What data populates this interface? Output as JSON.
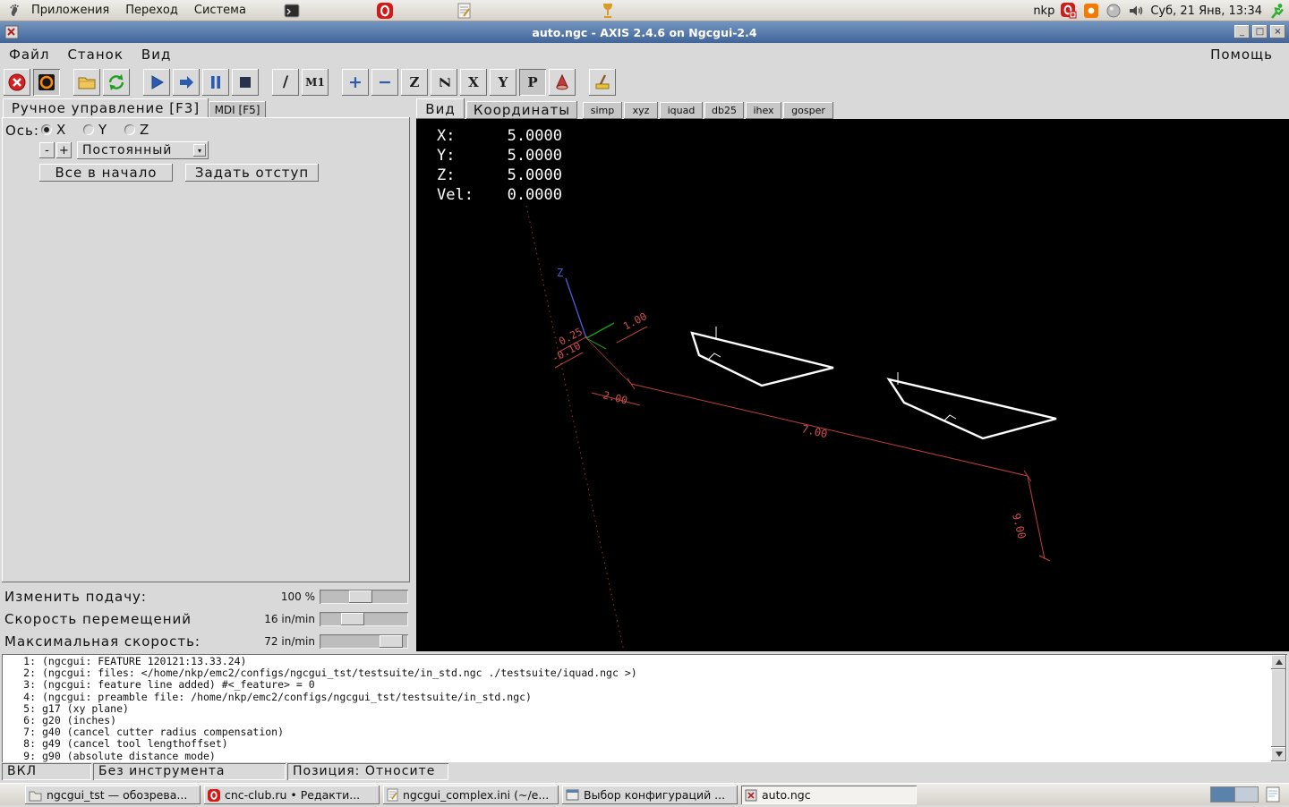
{
  "panel": {
    "menus": [
      "Приложения",
      "Переход",
      "Система"
    ],
    "username": "nkp",
    "clock": "Суб, 21 Янв, 13:34"
  },
  "titlebar": {
    "title": "auto.ngc - AXIS 2.4.6 on Ngcgui-2.4",
    "minimize": "_",
    "maximize": "□",
    "close": "×"
  },
  "menubar": {
    "file": "Файл",
    "machine": "Станок",
    "view": "Вид",
    "help": "Помощь"
  },
  "toolbar": {
    "block_delete": "/",
    "optional_stop": "M1",
    "zoom_in": "+",
    "zoom_out": "−",
    "view_top": "Z",
    "view_top_rot": "Z",
    "view_side": "X",
    "view_front": "Y",
    "view_persp": "P"
  },
  "left_panel": {
    "tab_manual": "Ручное управление [F3]",
    "tab_mdi": "MDI [F5]",
    "axis_label": "Ось:",
    "axis_x": "X",
    "axis_y": "Y",
    "axis_z": "Z",
    "jog_minus": "-",
    "jog_plus": "+",
    "jog_mode": "Постоянный",
    "jog_mode_arrow": "▾",
    "home_all": "Все в начало",
    "touch_off": "Задать отступ",
    "feed_label": "Изменить подачу:",
    "feed_value": "100 %",
    "jog_speed_label": "Скорость перемещений",
    "jog_speed_value": "16 in/min",
    "max_speed_label": "Максимальная скорость:",
    "max_speed_value": "72 in/min"
  },
  "preview": {
    "tab_view": "Вид",
    "tab_coords": "Координаты",
    "tab_simp": "simp",
    "tab_xyz": "xyz",
    "tab_iquad": "iquad",
    "tab_db25": "db25",
    "tab_ihex": "ihex",
    "tab_gosper": "gosper",
    "dro": {
      "x_label": "X:",
      "x_value": "5.0000",
      "y_label": "Y:",
      "y_value": "5.0000",
      "z_label": "Z:",
      "z_value": "5.0000",
      "vel_label": "Vel:",
      "vel_value": "0.0000"
    },
    "dims": {
      "d_1": "1.00",
      "d_025": "0.25",
      "d_010": "-0.10",
      "d_2": "2.00",
      "d_7": "7.00",
      "d_9": "9.00"
    },
    "axis_z_letter": "Z"
  },
  "gcode": {
    "lines": [
      {
        "num": "1:",
        "text": "(ngcgui: FEATURE 120121:13.33.24)"
      },
      {
        "num": "2:",
        "text": "(ngcgui: files: </home/nkp/emc2/configs/ngcgui_tst/testsuite/in_std.ngc ./testsuite/iquad.ngc >)"
      },
      {
        "num": "3:",
        "text": "(ngcgui: feature line added) #<_feature> = 0"
      },
      {
        "num": "4:",
        "text": "(ngcgui: preamble file: /home/nkp/emc2/configs/ngcgui_tst/testsuite/in_std.ngc)"
      },
      {
        "num": "5:",
        "text": "g17 (xy plane)"
      },
      {
        "num": "6:",
        "text": "g20 (inches)"
      },
      {
        "num": "7:",
        "text": "g40 (cancel cutter radius compensation)"
      },
      {
        "num": "8:",
        "text": "g49 (cancel tool lengthoffset)"
      },
      {
        "num": "9:",
        "text": "g90 (absolute distance mode)"
      }
    ]
  },
  "statusbar": {
    "power": "ВКЛ",
    "tool": "Без инструмента",
    "position": "Позиция: Относите"
  },
  "taskbar": {
    "items": [
      {
        "label": "ngcgui_tst — обозрева..."
      },
      {
        "label": "cnc-club.ru • Редакти..."
      },
      {
        "label": "ngcgui_complex.ini (~/e..."
      },
      {
        "label": "Выбор конфигураций ..."
      },
      {
        "label": "auto.ngc"
      }
    ]
  }
}
